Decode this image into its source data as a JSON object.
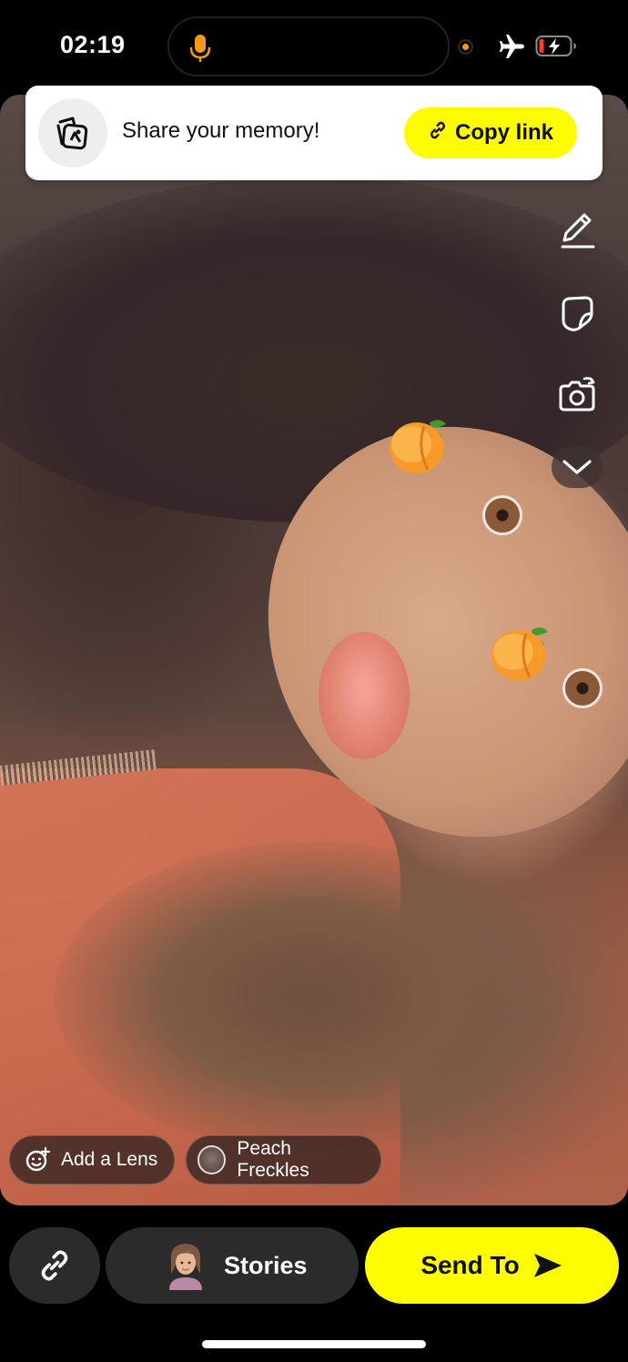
{
  "status_bar": {
    "time": "02:19",
    "mic_icon": "microphone-icon",
    "airplane_icon": "airplane-icon",
    "battery_icon": "battery-charging-icon",
    "battery_level": 0.15,
    "mic_color": "#f39a1a"
  },
  "share_banner": {
    "icon": "memories-icon",
    "text": "Share your memory!",
    "copy_link_label": "Copy link",
    "copy_link_icon": "link-icon"
  },
  "tools": [
    {
      "name": "pencil-icon"
    },
    {
      "name": "sticker-icon"
    },
    {
      "name": "camera-flip-icon"
    },
    {
      "name": "chevron-down-icon"
    }
  ],
  "lens_chips": {
    "add_lens_label": "Add a Lens",
    "add_lens_icon": "smiley-plus-icon",
    "active_lens_label": "Peach Freckles"
  },
  "bottom_bar": {
    "link_icon": "link-icon",
    "stories_label": "Stories",
    "send_label": "Send To",
    "send_icon": "send-arrow-icon"
  },
  "colors": {
    "accent_yellow": "#fffc00",
    "background": "#000000",
    "button_dark": "#2b2b2b"
  }
}
